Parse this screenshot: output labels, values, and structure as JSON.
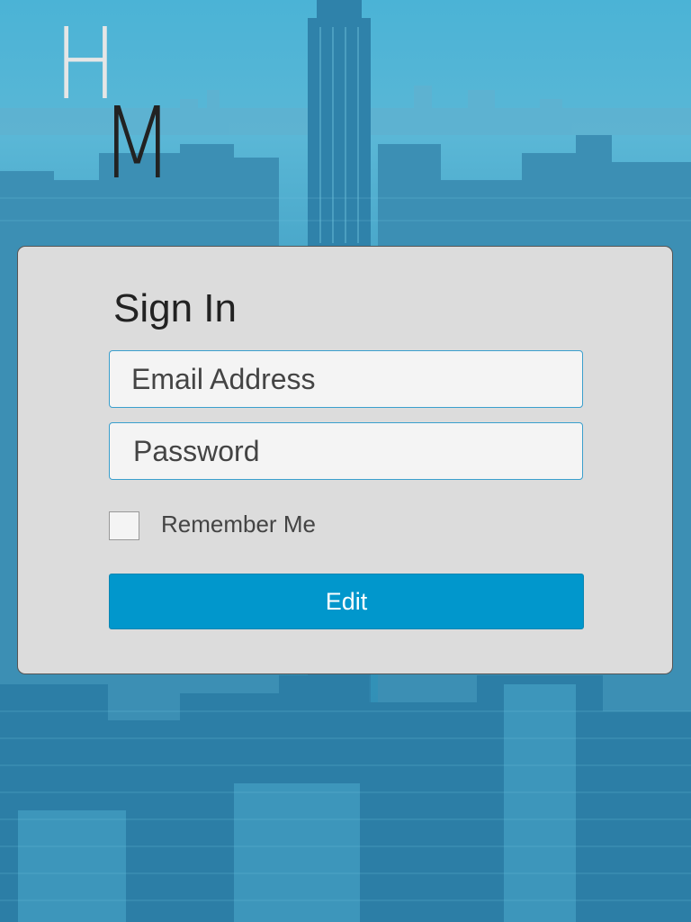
{
  "logo": {
    "letter_top": "H",
    "letter_bottom": "M"
  },
  "signin": {
    "title": "Sign In",
    "email_placeholder": "Email Address",
    "password_placeholder": "Password",
    "remember_label": "Remember Me",
    "remember_checked": false,
    "submit_label": "Edit"
  },
  "colors": {
    "background_tint": "#3aa3c8",
    "card": "#dcdcdc",
    "field_border": "#3a9fcd",
    "button": "#0197cc"
  }
}
